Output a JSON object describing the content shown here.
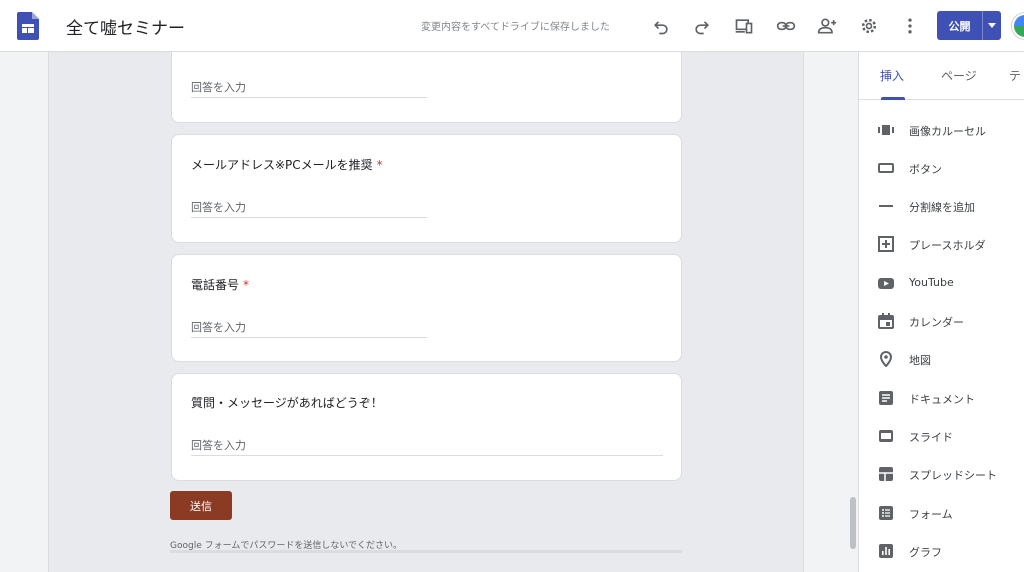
{
  "header": {
    "doc_title": "全て嘘セミナー",
    "save_status": "変更内容をすべてドライブに保存しました",
    "publish_label": "公開",
    "accent_color": "#3f51b5"
  },
  "toolbar": {
    "icons": [
      "undo-icon",
      "redo-icon",
      "preview-devices-icon",
      "link-icon",
      "add-person-icon",
      "settings-icon",
      "more-vert-icon"
    ]
  },
  "form": {
    "answer_placeholder": "回答を入力",
    "questions": [
      {
        "label": "",
        "required": false
      },
      {
        "label": "メールアドレス※PCメールを推奨",
        "required": true
      },
      {
        "label": "電話番号",
        "required": true
      },
      {
        "label": "質問・メッセージがあればどうぞ！",
        "required": false
      }
    ],
    "required_mark": "*",
    "submit_label": "送信",
    "submit_color": "#8b3a24",
    "footer_note": "Google フォームでパスワードを送信しないでください。"
  },
  "sidebar": {
    "tabs": [
      {
        "label": "挿入",
        "active": true
      },
      {
        "label": "ページ",
        "active": false
      },
      {
        "label": "テ",
        "active": false
      }
    ],
    "items": [
      {
        "label": "画像カルーセル",
        "icon": "carousel-icon"
      },
      {
        "label": "ボタン",
        "icon": "button-icon"
      },
      {
        "label": "分割線を追加",
        "icon": "divider-icon"
      },
      {
        "label": "プレースホルダ",
        "icon": "placeholder-icon"
      },
      {
        "label": "YouTube",
        "icon": "youtube-icon"
      },
      {
        "label": "カレンダー",
        "icon": "calendar-icon"
      },
      {
        "label": "地図",
        "icon": "map-pin-icon"
      },
      {
        "label": "ドキュメント",
        "icon": "document-icon"
      },
      {
        "label": "スライド",
        "icon": "slides-icon"
      },
      {
        "label": "スプレッドシート",
        "icon": "spreadsheet-icon"
      },
      {
        "label": "フォーム",
        "icon": "forms-icon"
      },
      {
        "label": "グラフ",
        "icon": "chart-icon"
      }
    ]
  }
}
